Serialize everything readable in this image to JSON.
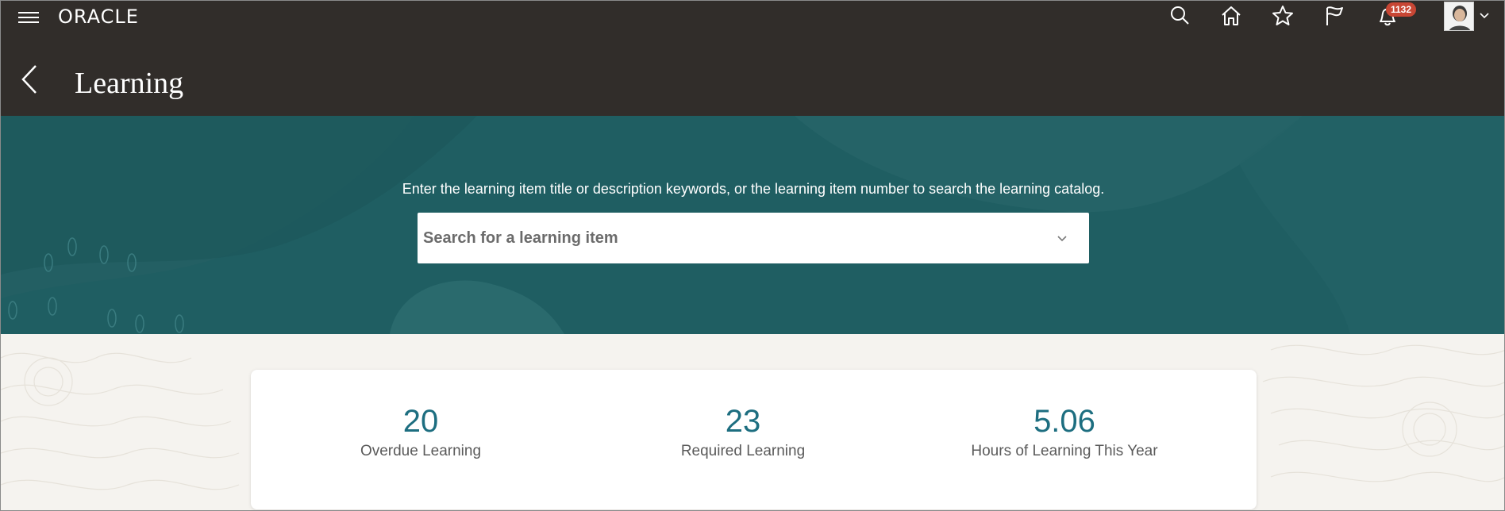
{
  "header": {
    "logo": "ORACLE",
    "notification_count": "1132",
    "page_title": "Learning"
  },
  "hero": {
    "instruction": "Enter the learning item title or description keywords, or the learning item number to search the learning catalog.",
    "search_placeholder": "Search for a learning item"
  },
  "metrics": [
    {
      "value": "20",
      "label": "Overdue Learning"
    },
    {
      "value": "23",
      "label": "Required Learning"
    },
    {
      "value": "5.06",
      "label": "Hours of Learning This Year"
    }
  ],
  "colors": {
    "header_bg": "#312d2a",
    "hero_bg": "#1f5e62",
    "metric_value": "#1d6e80",
    "badge": "#c74634"
  },
  "icons": [
    "menu-icon",
    "search-icon",
    "home-icon",
    "star-icon",
    "flag-icon",
    "notifications-icon",
    "avatar",
    "chevron-down-icon",
    "back-icon"
  ]
}
